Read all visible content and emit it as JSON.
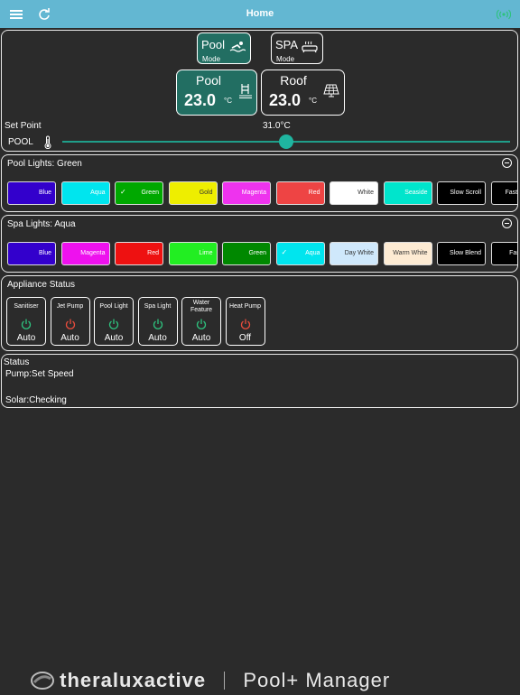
{
  "header": {
    "title": "Home",
    "menu_icon": "hamburger-icon",
    "refresh_icon": "refresh-icon",
    "signal_icon": "wireless-signal-icon",
    "signal_color": "#2ec27e"
  },
  "modes": [
    {
      "label": "Pool",
      "sub": "Mode",
      "icon": "swimmer-icon",
      "active": true
    },
    {
      "label": "SPA",
      "sub": "Mode",
      "icon": "bathtub-icon",
      "active": false
    }
  ],
  "temps": [
    {
      "name": "Pool",
      "value": "23.0",
      "unit": "°C",
      "icon": "pool-ladder-icon",
      "active": true
    },
    {
      "name": "Roof",
      "value": "23.0",
      "unit": "°C",
      "icon": "solar-panel-icon",
      "active": false
    }
  ],
  "setpoint": {
    "label": "Set Point",
    "value": "31.0°C",
    "target": "POOL",
    "icon": "thermometer-icon",
    "level": 0.5
  },
  "pool_lights": {
    "title": "Pool Lights: Green",
    "colors": [
      {
        "label": "Blue",
        "bg": "#3300cc",
        "fg": "#ffffff",
        "selected": false
      },
      {
        "label": "Aqua",
        "bg": "#00e5ee",
        "fg": "#ffffff",
        "selected": false
      },
      {
        "label": "Green",
        "bg": "#00a800",
        "fg": "#ffffff",
        "selected": true
      },
      {
        "label": "Gold",
        "bg": "#eeee00",
        "fg": "#333333",
        "selected": false
      },
      {
        "label": "Magenta",
        "bg": "#ee33ee",
        "fg": "#ffffff",
        "selected": false
      },
      {
        "label": "Red",
        "bg": "#ee4444",
        "fg": "#ffffff",
        "selected": false
      },
      {
        "label": "White",
        "bg": "#ffffff",
        "fg": "#333333",
        "selected": false
      },
      {
        "label": "Seaside",
        "bg": "#00e5cc",
        "fg": "#ffffff",
        "selected": false
      },
      {
        "label": "Slow Scroll",
        "bg": "#000000",
        "fg": "#ffffff",
        "selected": false
      },
      {
        "label": "Fast Scroll",
        "bg": "#000000",
        "fg": "#ffffff",
        "selected": false
      }
    ]
  },
  "spa_lights": {
    "title": "Spa Lights: Aqua",
    "colors": [
      {
        "label": "Blue",
        "bg": "#3300cc",
        "fg": "#ffffff",
        "selected": false
      },
      {
        "label": "Magenta",
        "bg": "#ee11ee",
        "fg": "#ffffff",
        "selected": false
      },
      {
        "label": "Red",
        "bg": "#ee1111",
        "fg": "#ffffff",
        "selected": false
      },
      {
        "label": "Lime",
        "bg": "#22ee22",
        "fg": "#ffffff",
        "selected": false
      },
      {
        "label": "Green",
        "bg": "#008800",
        "fg": "#ffffff",
        "selected": false
      },
      {
        "label": "Aqua",
        "bg": "#00e5ee",
        "fg": "#ffffff",
        "selected": true
      },
      {
        "label": "Day White",
        "bg": "#cfe8fb",
        "fg": "#333333",
        "selected": false
      },
      {
        "label": "Warm White",
        "bg": "#fdebd3",
        "fg": "#333333",
        "selected": false
      },
      {
        "label": "Slow Blend",
        "bg": "#000000",
        "fg": "#ffffff",
        "selected": false
      },
      {
        "label": "Fast Chg",
        "bg": "#000000",
        "fg": "#ffffff",
        "selected": false
      }
    ]
  },
  "appliances": {
    "title": "Appliance Status",
    "items": [
      {
        "name": "Sanitiser",
        "state": "Auto",
        "color": "#2ec27e"
      },
      {
        "name": "Jet Pump",
        "state": "Auto",
        "color": "#e74c3c"
      },
      {
        "name": "Pool Light",
        "state": "Auto",
        "color": "#2ec27e"
      },
      {
        "name": "Spa Light",
        "state": "Auto",
        "color": "#2ec27e"
      },
      {
        "name": "Water Feature",
        "state": "Auto",
        "color": "#2ec27e"
      },
      {
        "name": "Heat Pump",
        "state": "Off",
        "color": "#e74c3c"
      }
    ]
  },
  "status": {
    "title": "Status",
    "pump": "Pump:Set Speed",
    "solar": "Solar:Checking"
  },
  "footer": {
    "brand": "theraluxactive",
    "product": "Pool+ Manager"
  },
  "colors": {
    "accent": "#1f9e8a",
    "active_bg": "#226e62",
    "topbar": "#63b7d2"
  }
}
